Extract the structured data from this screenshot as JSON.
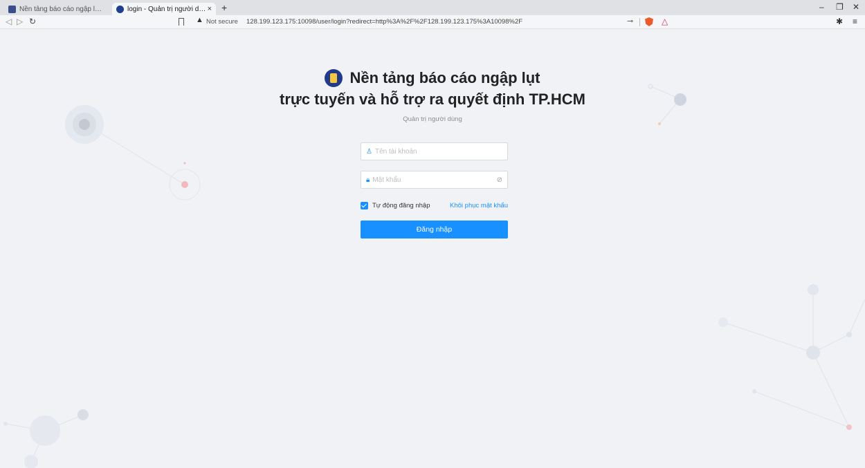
{
  "browser": {
    "tabs": [
      {
        "label": "Nền tảng báo cáo ngập lụt trực tuyến",
        "active": false
      },
      {
        "label": "login - Quản trị người dùng",
        "active": true
      }
    ],
    "new_tab": "+",
    "close": "×",
    "security_label": "Not secure",
    "url": "128.199.123.175:10098/user/login?redirect=http%3A%2F%2F128.199.123.175%3A10098%2F"
  },
  "page": {
    "title_line1": "Nền tảng báo cáo ngập lụt",
    "title_line2": "trực tuyến và hỗ trợ ra quyết định TP.HCM",
    "subtitle": "Quản trị người dùng",
    "username_placeholder": "Tên tài khoản",
    "password_placeholder": "Mật khẩu",
    "remember_label": "Tự động đăng nhập",
    "remember_checked": true,
    "forgot_label": "Khôi phục mật khẩu",
    "submit_label": "Đăng nhập"
  },
  "colors": {
    "accent": "#1890ff",
    "background": "#f0f2f5"
  }
}
